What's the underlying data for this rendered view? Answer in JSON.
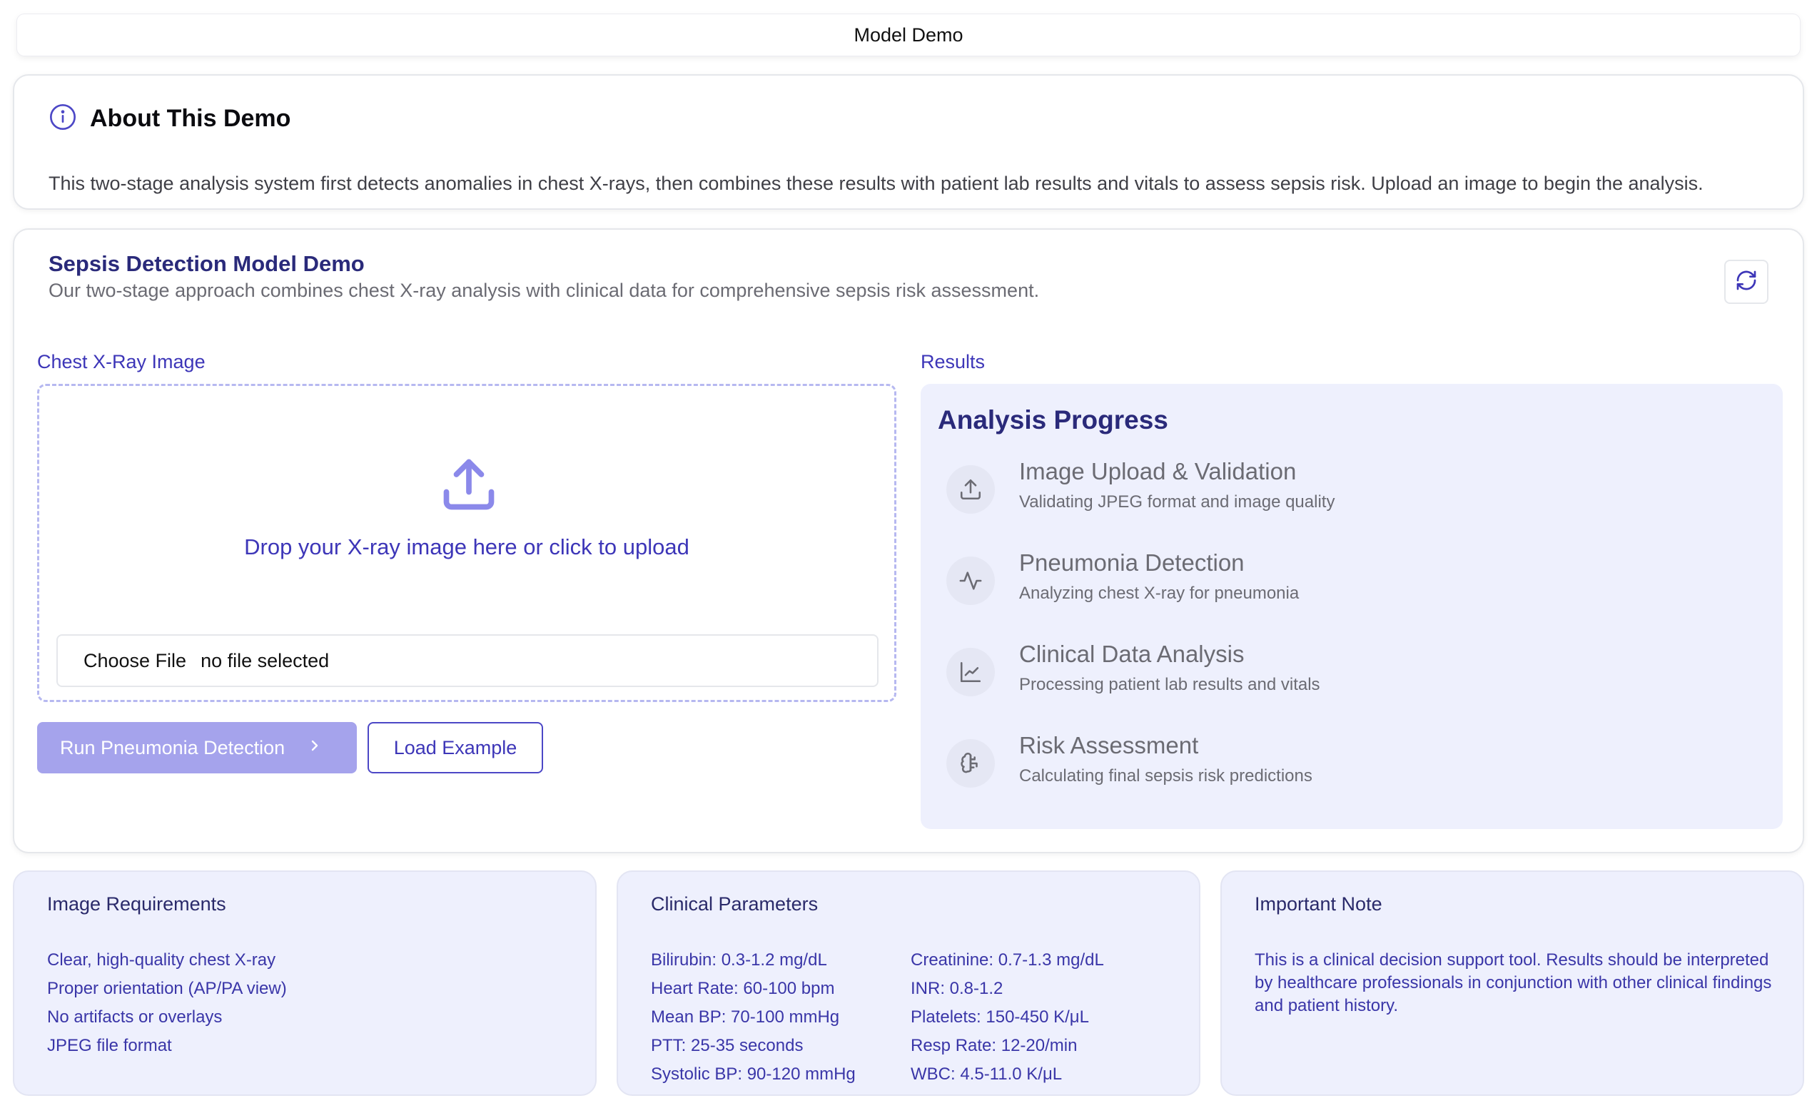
{
  "topbar": {
    "title": "Model Demo"
  },
  "about": {
    "title": "About This Demo",
    "text": "This two-stage analysis system first detects anomalies in chest X-rays, then combines these results with patient lab results and vitals to assess sepsis risk. Upload an image to begin the analysis."
  },
  "demo": {
    "title": "Sepsis Detection Model Demo",
    "subtitle": "Our two-stage approach combines chest X-ray analysis with clinical data for comprehensive sepsis risk assessment.",
    "refresh_icon": "refresh-icon"
  },
  "upload": {
    "label": "Chest X-Ray Image",
    "drop_text": "Drop your X-ray image here or click to upload",
    "choose_file": "Choose File",
    "no_file": "no file selected",
    "icon": "upload-icon"
  },
  "actions": {
    "run_label": "Run Pneumonia Detection",
    "example_label": "Load Example"
  },
  "results": {
    "label": "Results",
    "title": "Analysis Progress",
    "steps": [
      {
        "title": "Image Upload & Validation",
        "desc": "Validating JPEG format and image quality",
        "icon": "upload-icon"
      },
      {
        "title": "Pneumonia Detection",
        "desc": "Analyzing chest X-ray for pneumonia",
        "icon": "activity-icon"
      },
      {
        "title": "Clinical Data Analysis",
        "desc": "Processing patient lab results and vitals",
        "icon": "line-chart-icon"
      },
      {
        "title": "Risk Assessment",
        "desc": "Calculating final sepsis risk predictions",
        "icon": "brain-icon"
      }
    ]
  },
  "requirements": {
    "title": "Image Requirements",
    "items": [
      "Clear, high-quality chest X-ray",
      "Proper orientation (AP/PA view)",
      "No artifacts or overlays",
      "JPEG file format"
    ]
  },
  "clinical": {
    "title": "Clinical Parameters",
    "col1": [
      "Bilirubin: 0.3-1.2 mg/dL",
      "Heart Rate: 60-100 bpm",
      "Mean BP: 70-100 mmHg",
      "PTT: 25-35 seconds",
      "Systolic BP: 90-120 mmHg"
    ],
    "col2": [
      "Creatinine: 0.7-1.3 mg/dL",
      "INR: 0.8-1.2",
      "Platelets: 150-450 K/μL",
      "Resp Rate: 12-20/min",
      "WBC: 4.5-11.0 K/μL"
    ]
  },
  "note": {
    "title": "Important Note",
    "text": "This is a clinical decision support tool. Results should be interpreted by healthcare professionals in conjunction with other clinical findings and patient history."
  },
  "colors": {
    "accent": "#3d36b8",
    "accent_light": "#a5a3ec",
    "panel_bg": "#eef0fd"
  }
}
